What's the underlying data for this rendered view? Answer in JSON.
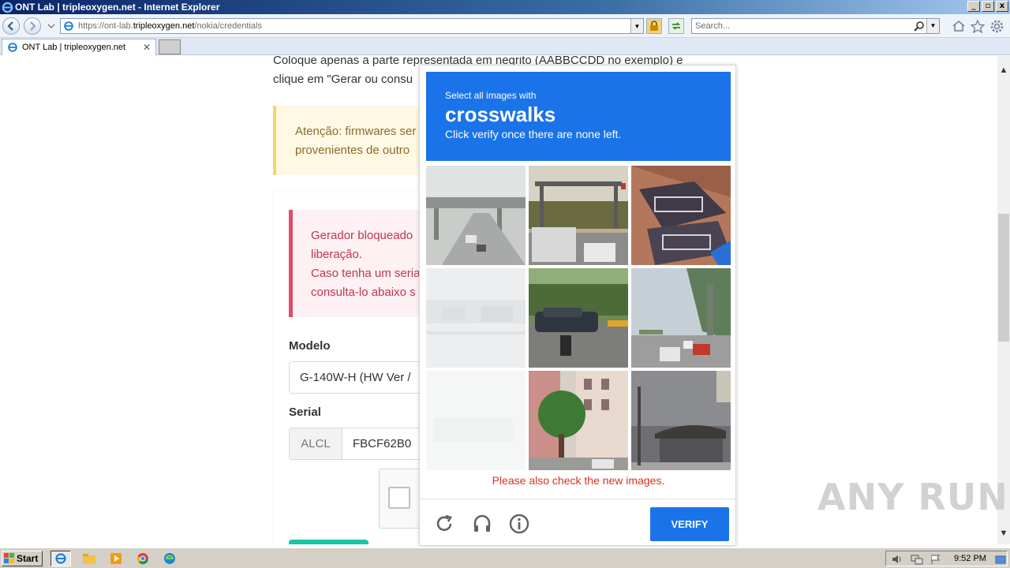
{
  "window": {
    "title": "ONT Lab | tripleoxygen.net - Internet Explorer",
    "controls": [
      "_",
      "▫",
      "x"
    ]
  },
  "browser": {
    "url_prefix": "https://ont-lab.",
    "url_domain": "tripleoxygen.net",
    "url_path": "/nokia/credentials",
    "search_placeholder": "Search...",
    "tab_title": "ONT Lab | tripleoxygen.net"
  },
  "page": {
    "intro_line1": "Coloque apenas a parte representada em negrito (AABBCCDD no exemplo) e",
    "intro_line2": "clique em \"Gerar ou consu",
    "warning_line1": "Atenção: firmwares ser",
    "warning_line2": "provenientes de outro",
    "danger_line1": "Gerador bloqueado",
    "danger_line2": "liberação.",
    "danger_line3": "Caso tenha um seria",
    "danger_line4": "consulta-lo abaixo s",
    "model_label": "Modelo",
    "model_value": "G-140W-H (HW Ver /",
    "serial_label": "Serial",
    "serial_prefix": "ALCL",
    "serial_value": "FBCF62B0"
  },
  "captcha": {
    "prompt_pre": "Select all images with",
    "prompt_word": "crosswalks",
    "prompt_sub": "Click verify once there are none left.",
    "error": "Please also check the new images.",
    "verify_label": "VERIFY",
    "tiles": [
      {
        "name": "highway-overpass",
        "faded": false
      },
      {
        "name": "gantry-road-cars",
        "faded": false
      },
      {
        "name": "building-balcony",
        "faded": false
      },
      {
        "name": "street-faded",
        "faded": true
      },
      {
        "name": "car-motorbike",
        "faded": false
      },
      {
        "name": "elevated-road-cars",
        "faded": false
      },
      {
        "name": "blank-faded",
        "faded": true
      },
      {
        "name": "tree-building",
        "faded": false
      },
      {
        "name": "bus-stop-building",
        "faded": false
      }
    ]
  },
  "watermark": "ANY RUN",
  "taskbar": {
    "start_label": "Start",
    "clock": "9:52 PM"
  },
  "colors": {
    "captcha_blue": "#1a73e8",
    "error_red": "#d93025",
    "warning_bg": "#fef8e4",
    "danger_bg": "#fdf1f3"
  }
}
